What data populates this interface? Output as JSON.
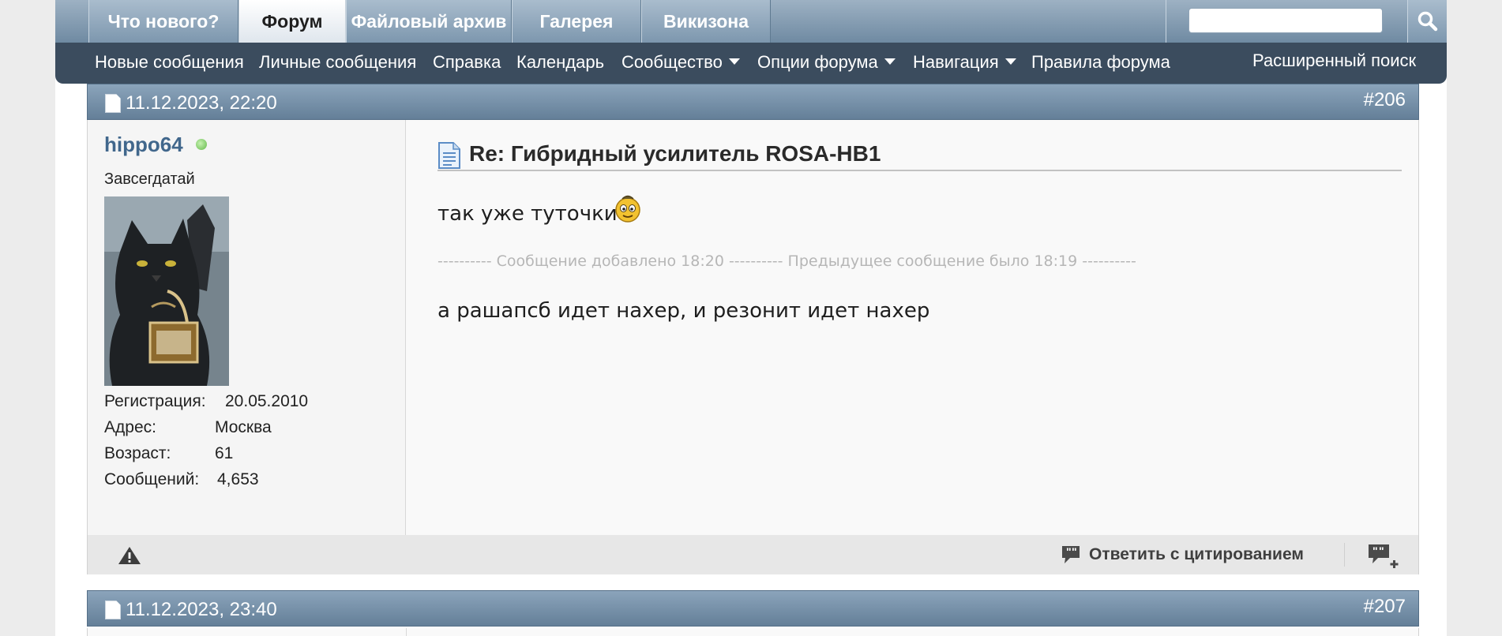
{
  "nav": {
    "tabs": [
      {
        "label": "Что нового?",
        "active": false
      },
      {
        "label": "Форум",
        "active": true
      },
      {
        "label": "Файловый архив",
        "active": false
      },
      {
        "label": "Галерея",
        "active": false
      },
      {
        "label": "Викизона",
        "active": false
      }
    ],
    "search": {
      "value": "",
      "placeholder": ""
    }
  },
  "subnav": {
    "items": [
      {
        "label": "Новые сообщения",
        "dropdown": false
      },
      {
        "label": "Личные сообщения",
        "dropdown": false
      },
      {
        "label": "Справка",
        "dropdown": false
      },
      {
        "label": "Календарь",
        "dropdown": false
      },
      {
        "label": "Сообщество",
        "dropdown": true
      },
      {
        "label": "Опции форума",
        "dropdown": true
      },
      {
        "label": "Навигация",
        "dropdown": true
      },
      {
        "label": "Правила форума",
        "dropdown": false
      }
    ],
    "advanced_search": "Расширенный поиск"
  },
  "posts": [
    {
      "date": "11.12.2023, 22:20",
      "number": "#206",
      "user": {
        "name": "hippo64",
        "online": true,
        "title": "Завсегдатай",
        "stats": [
          {
            "label": "Регистрация:",
            "value": "20.05.2010"
          },
          {
            "label": "Адрес:",
            "value": "Москва"
          },
          {
            "label": "Возраст:",
            "value": "61"
          },
          {
            "label": "Сообщений:",
            "value": "4,653"
          }
        ]
      },
      "title": "Re: Гибридный усилитель ROSA-HB1",
      "line1": "так уже туточки",
      "merge_notice": "---------- Сообщение добавлено 18:20 ---------- Предыдущее сообщение было 18:19 ----------",
      "line2": "а рашапсб идет нахер, и резонит идет нахер",
      "quote_label": "Ответить с цитированием"
    },
    {
      "date": "11.12.2023, 23:40",
      "number": "#207"
    }
  ],
  "colors": {
    "tab_gradient_top": "#a9bccd",
    "subnav_bg": "#3b4c5e",
    "post_header": "#7692ab",
    "username": "#41678c",
    "online_dot": "#63b84a"
  }
}
